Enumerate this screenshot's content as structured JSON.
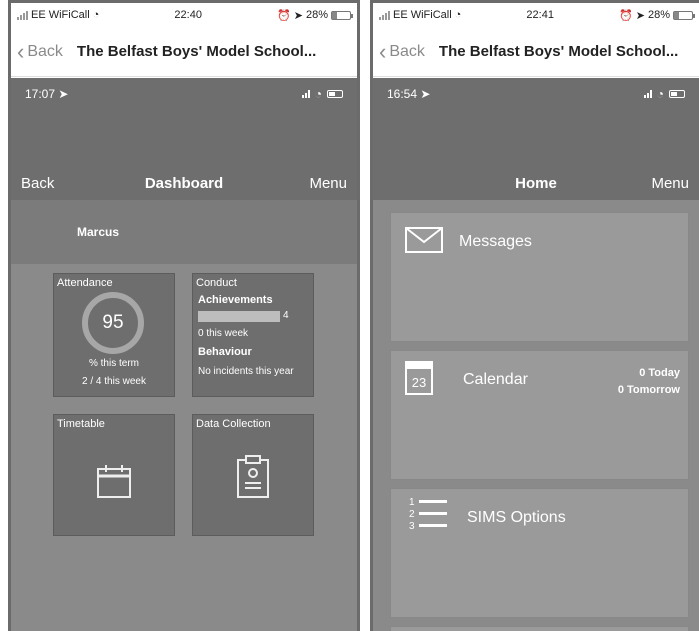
{
  "left": {
    "status": {
      "carrier": "EE WiFiCall",
      "time": "22:40",
      "battery": "28%"
    },
    "browser": {
      "back_label": "Back",
      "title": "The Belfast Boys' Model School..."
    },
    "app_status": {
      "time": "17:07"
    },
    "header": {
      "back": "Back",
      "title": "Dashboard",
      "menu": "Menu"
    },
    "pupil_name": "Marcus",
    "attendance": {
      "label": "Attendance",
      "value": "95",
      "line1": "% this term",
      "line2": "2 / 4 this week",
      "fraction": 0.95
    },
    "conduct": {
      "label": "Conduct",
      "achievements_label": "Achievements",
      "achievements_value": "4",
      "achievements_week": "0 this week",
      "behaviour_label": "Behaviour",
      "behaviour_text": "No incidents this year"
    },
    "timetable": {
      "label": "Timetable",
      "icon": "calendar-icon"
    },
    "data_collection": {
      "label": "Data Collection",
      "icon": "clipboard-icon"
    }
  },
  "right": {
    "status": {
      "carrier": "EE WiFiCall",
      "time": "22:41",
      "battery": "28%"
    },
    "browser": {
      "back_label": "Back",
      "title": "The Belfast Boys' Model School..."
    },
    "app_status": {
      "time": "16:54"
    },
    "header": {
      "title": "Home",
      "menu": "Menu"
    },
    "cards": {
      "messages": {
        "label": "Messages",
        "icon": "envelope-icon"
      },
      "calendar": {
        "label": "Calendar",
        "day": "23",
        "today": "0 Today",
        "tomorrow": "0 Tomorrow",
        "icon": "calendar-icon"
      },
      "sims": {
        "label": "SIMS Options",
        "icon": "numbered-list-icon"
      }
    }
  }
}
